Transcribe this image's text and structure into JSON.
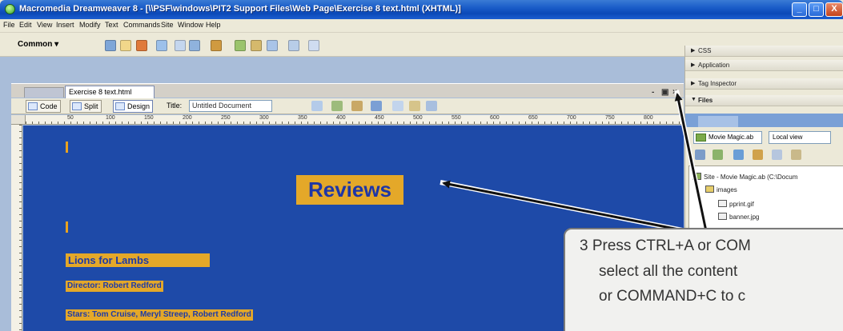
{
  "window": {
    "title": "Macromedia Dreamweaver 8 - [\\\\PSF\\windows\\PIT2 Support Files\\Web Page\\Exercise 8 text.html (XHTML)]",
    "buttons": {
      "minimize": "_",
      "maximize": "□",
      "close": "X"
    }
  },
  "menubar": {
    "items": [
      "File",
      "Edit",
      "View",
      "Insert",
      "Modify",
      "Text",
      "Commands",
      "Site",
      "Window",
      "Help"
    ]
  },
  "insert_bar": {
    "category": "Common ▾"
  },
  "document": {
    "tabs": [
      "",
      "Exercise 8 text.html"
    ],
    "panel_controls": {
      "minimize": "-",
      "restore": "▣",
      "close": "×"
    },
    "toolbar": {
      "code_label": "Code",
      "split_label": "Split",
      "design_label": "Design",
      "title_label": "Title:",
      "title_value": "Untitled Document"
    },
    "ruler_marks": [
      "50",
      "100",
      "150",
      "200",
      "250",
      "300",
      "350",
      "400",
      "450",
      "500",
      "550",
      "600",
      "650",
      "700",
      "750",
      "800"
    ],
    "content": {
      "heading": "Reviews",
      "film_title": "Lions for Lambs",
      "director": "Director: Robert Redford",
      "stars": "Stars: Tom Cruise, Meryl Streep, Robert Redford"
    }
  },
  "right_panels": {
    "css": "CSS",
    "application": "Application",
    "tag_inspector": "Tag Inspector",
    "files": "Files",
    "site_select": "Movie Magic.ab",
    "view_select": "Local view",
    "tree": [
      "Site - Movie Magic.ab (C:\\Docum",
      "images",
      "pprint.gif",
      "banner.jpg"
    ]
  },
  "annotation": {
    "lines": [
      "3  Press CTRL+A or COM",
      "select all the content",
      "or COMMAND+C to c"
    ]
  },
  "colors": {
    "canvas": "#1e4aa8",
    "highlight": "#e4a829",
    "heading_text": "#1e36a6",
    "titlebar": "#0b49b8"
  }
}
